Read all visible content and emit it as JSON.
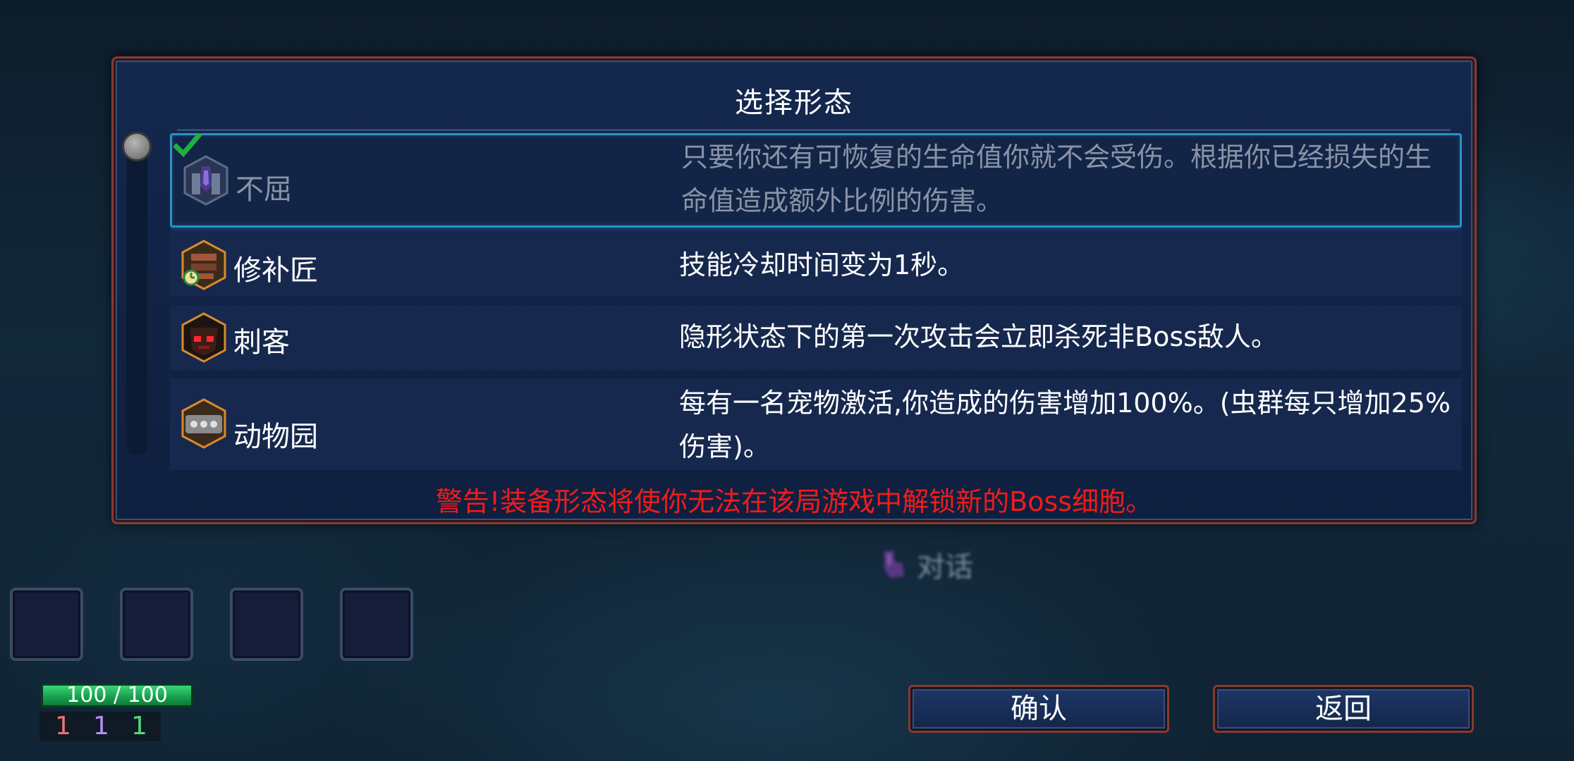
{
  "dialog": {
    "title": "选择形态",
    "warning": "警告!装备形态将使你无法在该局游戏中解锁新的Boss细胞。"
  },
  "forms": [
    {
      "name": "不屈",
      "description": "只要你还有可恢复的生命值你就不会受伤。根据你已经损失的生命值造成额外比例的伤害。",
      "icon": "undying-icon",
      "selected": true
    },
    {
      "name": "修补匠",
      "description": "技能冷却时间变为1秒。",
      "icon": "tinkerer-icon",
      "selected": false
    },
    {
      "name": "刺客",
      "description": "隐形状态下的第一次攻击会立即杀死非Boss敌人。",
      "icon": "assassin-icon",
      "selected": false
    },
    {
      "name": "动物园",
      "description": "每有一名宠物激活,你造成的伤害增加100%。(虫群每只增加25%伤害)。",
      "icon": "zoo-icon",
      "selected": false
    }
  ],
  "talk_prompt": "对话",
  "hud": {
    "health": "100 / 100",
    "health_fraction": 1.0,
    "scrolls": [
      {
        "value": "1",
        "color": "#e8776e"
      },
      {
        "value": "1",
        "color": "#b58ef0"
      },
      {
        "value": "1",
        "color": "#4fdc7a"
      }
    ],
    "slots": 4
  },
  "buttons": {
    "confirm": "确认",
    "back": "返回"
  },
  "colors": {
    "warning": "#f21b1b",
    "selected_border": "#2b90c8",
    "frame_border": "#8a3a2e",
    "health_green": "#18a24e"
  }
}
